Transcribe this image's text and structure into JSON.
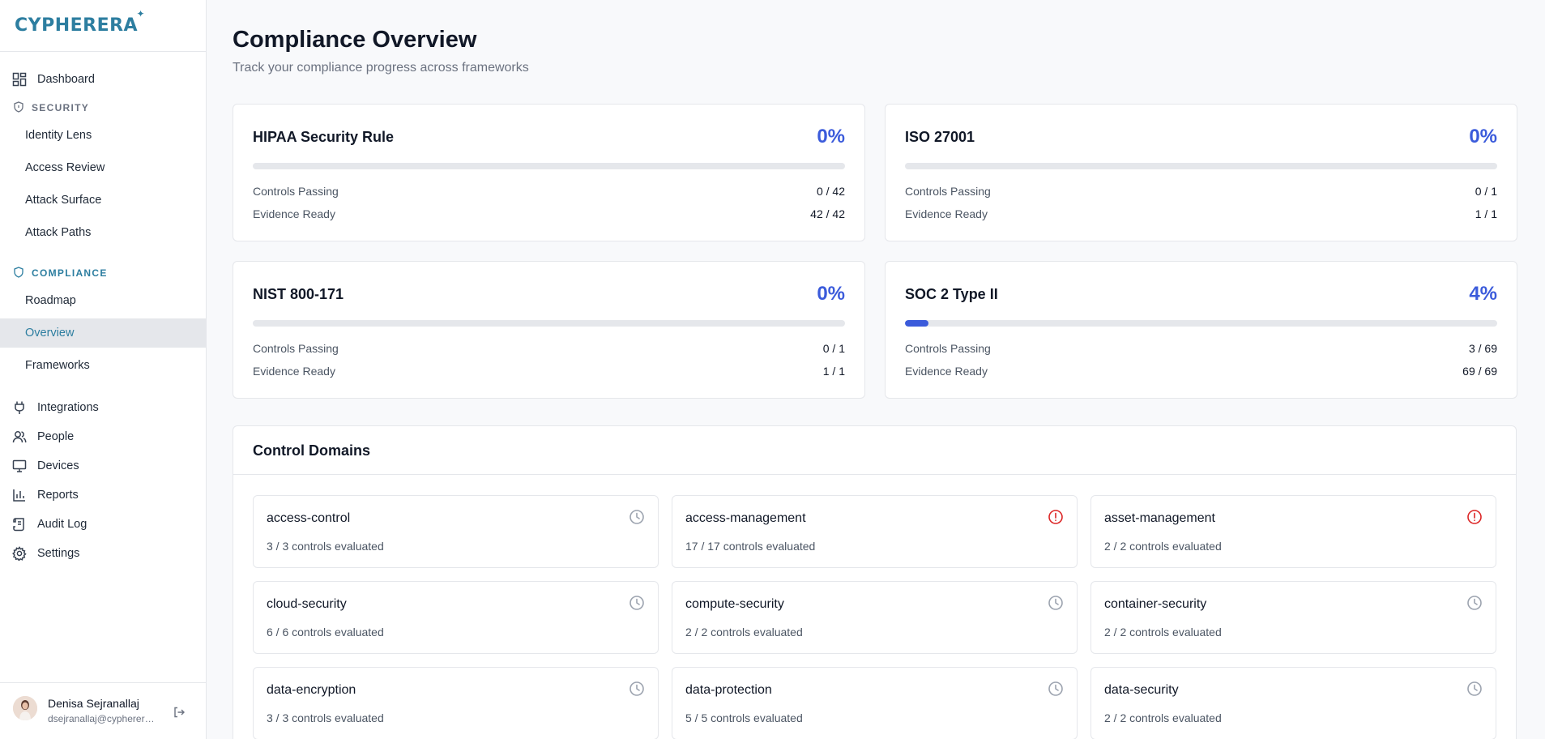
{
  "brand": {
    "logo_text": "CYPHERERA",
    "logo_mark": "✦"
  },
  "sidebar": {
    "dashboard": {
      "label": "Dashboard",
      "icon": "dashboard-icon"
    },
    "security_section": {
      "label": "SECURITY",
      "icon": "shield-icon"
    },
    "security_items": [
      {
        "label": "Identity Lens"
      },
      {
        "label": "Access Review"
      },
      {
        "label": "Attack Surface"
      },
      {
        "label": "Attack Paths"
      }
    ],
    "compliance_section": {
      "label": "COMPLIANCE",
      "icon": "shield-icon"
    },
    "compliance_items": [
      {
        "label": "Roadmap"
      },
      {
        "label": "Overview",
        "active": true
      },
      {
        "label": "Frameworks"
      }
    ],
    "bottom_items": [
      {
        "label": "Integrations",
        "icon": "plug-icon"
      },
      {
        "label": "People",
        "icon": "people-icon"
      },
      {
        "label": "Devices",
        "icon": "monitor-icon"
      },
      {
        "label": "Reports",
        "icon": "bar-chart-icon"
      },
      {
        "label": "Audit Log",
        "icon": "scroll-icon"
      },
      {
        "label": "Settings",
        "icon": "gear-icon"
      }
    ],
    "user": {
      "name": "Denisa Sejranallaj",
      "email": "dsejranallaj@cypherera.com"
    }
  },
  "page": {
    "title": "Compliance Overview",
    "subtitle": "Track your compliance progress across frameworks"
  },
  "frameworks": [
    {
      "name": "HIPAA Security Rule",
      "percent": "0%",
      "progress": 0,
      "controls_label": "Controls Passing",
      "controls": "0 / 42",
      "evidence_label": "Evidence Ready",
      "evidence": "42 / 42"
    },
    {
      "name": "ISO 27001",
      "percent": "0%",
      "progress": 0,
      "controls_label": "Controls Passing",
      "controls": "0 / 1",
      "evidence_label": "Evidence Ready",
      "evidence": "1 / 1"
    },
    {
      "name": "NIST 800-171",
      "percent": "0%",
      "progress": 0,
      "controls_label": "Controls Passing",
      "controls": "0 / 1",
      "evidence_label": "Evidence Ready",
      "evidence": "1 / 1"
    },
    {
      "name": "SOC 2 Type II",
      "percent": "4%",
      "progress": 4,
      "controls_label": "Controls Passing",
      "controls": "3 / 69",
      "evidence_label": "Evidence Ready",
      "evidence": "69 / 69"
    }
  ],
  "control_domains": {
    "title": "Control Domains",
    "colors": {
      "pending": "#9ca3af",
      "alert": "#dc2626"
    },
    "items": [
      {
        "name": "access-control",
        "count": "3 / 3 controls evaluated",
        "status": "clock-icon"
      },
      {
        "name": "access-management",
        "count": "17 / 17 controls evaluated",
        "status": "alert-circle-icon"
      },
      {
        "name": "asset-management",
        "count": "2 / 2 controls evaluated",
        "status": "alert-circle-icon"
      },
      {
        "name": "cloud-security",
        "count": "6 / 6 controls evaluated",
        "status": "clock-icon"
      },
      {
        "name": "compute-security",
        "count": "2 / 2 controls evaluated",
        "status": "clock-icon"
      },
      {
        "name": "container-security",
        "count": "2 / 2 controls evaluated",
        "status": "clock-icon"
      },
      {
        "name": "data-encryption",
        "count": "3 / 3 controls evaluated",
        "status": "clock-icon"
      },
      {
        "name": "data-protection",
        "count": "5 / 5 controls evaluated",
        "status": "clock-icon"
      },
      {
        "name": "data-security",
        "count": "2 / 2 controls evaluated",
        "status": "clock-icon"
      }
    ]
  }
}
